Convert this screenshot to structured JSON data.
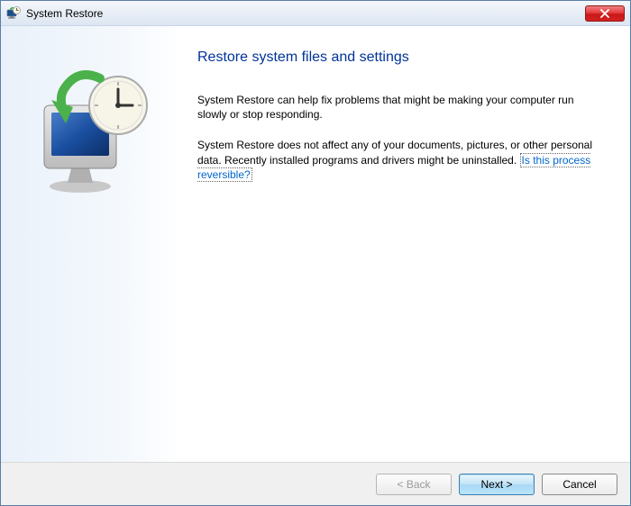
{
  "titlebar": {
    "title": "System Restore"
  },
  "main": {
    "heading": "Restore system files and settings",
    "paragraph1": "System Restore can help fix problems that might be making your computer run slowly or stop responding.",
    "paragraph2_prefix": "System Restore does not affect any of your documents, pictures, or other personal data. Recently installed programs and drivers might be uninstalled. ",
    "link_text": "Is this process reversible?"
  },
  "footer": {
    "back_label": "< Back",
    "next_label": "Next >",
    "cancel_label": "Cancel"
  }
}
